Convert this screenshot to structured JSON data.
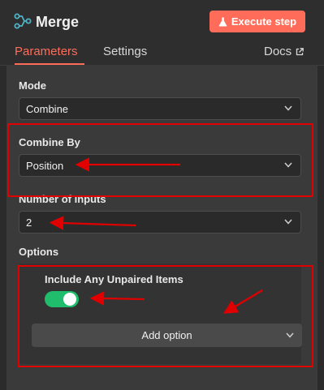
{
  "node": {
    "title": "Merge",
    "execute_label": "Execute step"
  },
  "tabs": {
    "parameters": "Parameters",
    "settings": "Settings",
    "docs": "Docs"
  },
  "fields": {
    "mode": {
      "label": "Mode",
      "value": "Combine"
    },
    "combine_by": {
      "label": "Combine By",
      "value": "Position"
    },
    "number_of_inputs": {
      "label": "Number of Inputs",
      "value": "2"
    }
  },
  "options": {
    "label": "Options",
    "include_unpaired": {
      "label": "Include Any Unpaired Items",
      "enabled": true
    },
    "add_option_label": "Add option"
  },
  "colors": {
    "accent": "#ff6d5a",
    "toggle_on": "#1fbd6c",
    "annotation": "#e00000"
  },
  "icons": [
    "merge-node-icon",
    "flask-icon",
    "external-link-icon",
    "chevron-down-icon"
  ]
}
